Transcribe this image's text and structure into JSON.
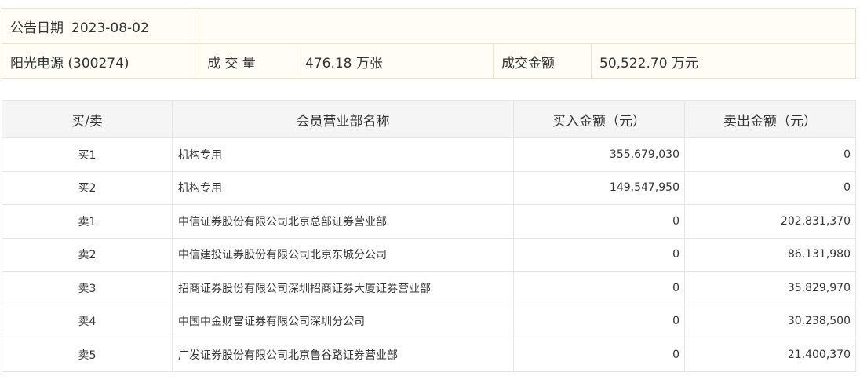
{
  "info": {
    "date_label": "公告日期",
    "date_value": "2023-08-02",
    "stock": "阳光电源 (300274)",
    "volume_label": "成 交 量",
    "volume_value": "476.18 万张",
    "amount_label": "成交金额",
    "amount_value": "50,522.70 万元"
  },
  "table": {
    "headers": [
      "买/卖",
      "会员营业部名称",
      "买入金额（元）",
      "卖出金额（元）"
    ],
    "rows": [
      {
        "side": "买1",
        "name": "机构专用",
        "buy": "355,679,030",
        "sell": "0"
      },
      {
        "side": "买2",
        "name": "机构专用",
        "buy": "149,547,950",
        "sell": "0"
      },
      {
        "side": "卖1",
        "name": "中信证券股份有限公司北京总部证券营业部",
        "buy": "0",
        "sell": "202,831,370"
      },
      {
        "side": "卖2",
        "name": "中信建投证券股份有限公司北京东城分公司",
        "buy": "0",
        "sell": "86,131,980"
      },
      {
        "side": "卖3",
        "name": "招商证券股份有限公司深圳招商证券大厦证券营业部",
        "buy": "0",
        "sell": "35,829,970"
      },
      {
        "side": "卖4",
        "name": "中国中金财富证券有限公司深圳分公司",
        "buy": "0",
        "sell": "30,238,500"
      },
      {
        "side": "卖5",
        "name": "广发证券股份有限公司北京鲁谷路证券营业部",
        "buy": "0",
        "sell": "21,400,370"
      }
    ]
  }
}
